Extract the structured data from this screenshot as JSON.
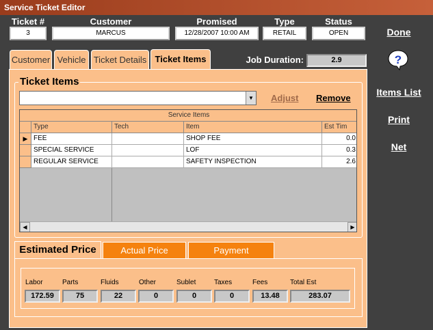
{
  "window": {
    "title": "Service Ticket Editor"
  },
  "header": {
    "ticket_label": "Ticket #",
    "ticket_value": "3",
    "customer_label": "Customer",
    "customer_value": "MARCUS",
    "promised_label": "Promised",
    "promised_value": "12/28/2007 10:00 AM",
    "type_label": "Type",
    "type_value": "RETAIL",
    "status_label": "Status",
    "status_value": "OPEN"
  },
  "tabs": [
    {
      "label": "Customer"
    },
    {
      "label": "Vehicle"
    },
    {
      "label": "Ticket Details"
    },
    {
      "label": "Ticket Items"
    }
  ],
  "job_duration": {
    "label": "Job Duration:",
    "value": "2.9"
  },
  "ticket_items": {
    "group_title": "Ticket Items",
    "combo_value": "",
    "adjust_label": "Adjust",
    "remove_label": "Remove",
    "grid": {
      "band_title": "Service Items",
      "columns": [
        "Type",
        "Tech",
        "Item",
        "Est Tim"
      ],
      "rows": [
        {
          "type": "FEE",
          "tech": "",
          "item": "SHOP FEE",
          "est": "0.0"
        },
        {
          "type": "SPECIAL SERVICE",
          "tech": "",
          "item": "LOF",
          "est": "0.3"
        },
        {
          "type": "REGULAR SERVICE",
          "tech": "",
          "item": "SAFETY INSPECTION",
          "est": "2.6"
        }
      ]
    }
  },
  "price_tabs": [
    {
      "label": "Estimated Price"
    },
    {
      "label": "Actual Price"
    },
    {
      "label": "Payment"
    }
  ],
  "price": {
    "labels": [
      "Labor",
      "Parts",
      "Fluids",
      "Other",
      "Sublet",
      "Taxes",
      "Fees",
      "Total Est"
    ],
    "values": [
      "172.59",
      "75",
      "22",
      "0",
      "0",
      "0",
      "13.48",
      "283.07"
    ]
  },
  "side": {
    "done": "Done",
    "help_icon": "question-help-icon",
    "items_list": "Items List",
    "print": "Print",
    "net": "Net"
  },
  "colors": {
    "background": "#404040",
    "panel": "#fbbf8a",
    "tab_inactive": "#f5820f",
    "title_bar": "#9a3c1c",
    "adjust_disabled": "#a06a4a",
    "remove": "#000000"
  }
}
